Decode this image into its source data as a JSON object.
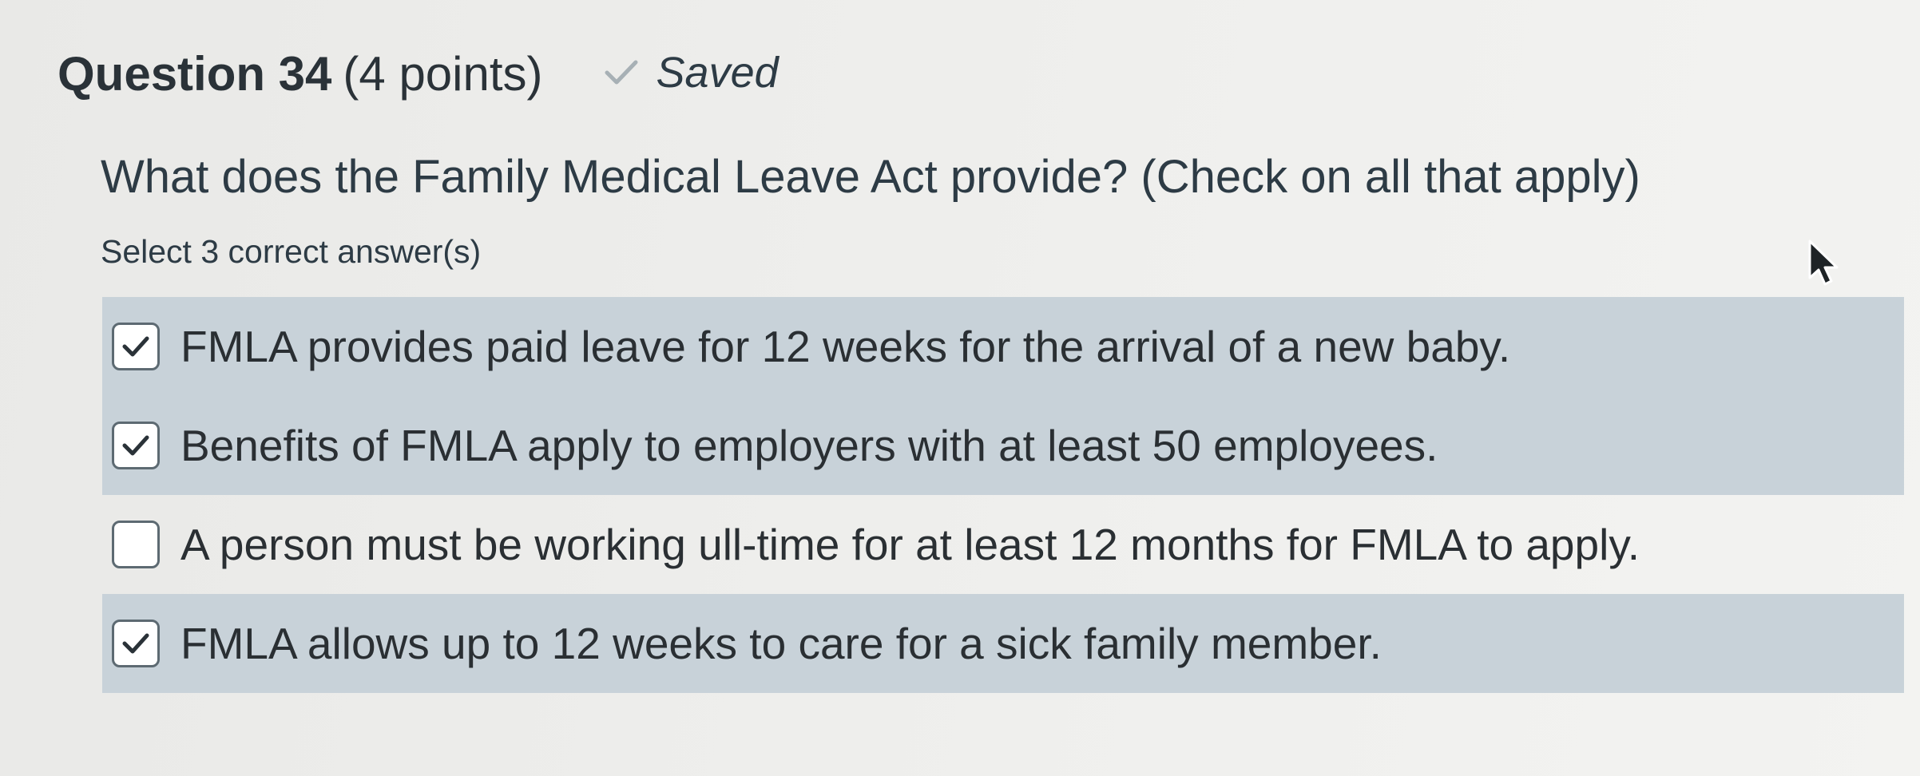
{
  "question": {
    "title": "Question 34",
    "points": "(4 points)",
    "saved_label": "Saved",
    "saved_icon": "check-icon",
    "prompt": "What does the Family Medical Leave Act provide? (Check on all that apply)",
    "instruction": "Select 3 correct answer(s)"
  },
  "answers": [
    {
      "text": "FMLA provides paid leave for 12 weeks for the arrival of a new baby.",
      "checked": true
    },
    {
      "text": "Benefits of FMLA apply to employers with at least 50 employees.",
      "checked": true
    },
    {
      "text": "A person must be working ull-time for at least 12 months for FMLA to apply.",
      "checked": false
    },
    {
      "text": "FMLA allows up to 12 weeks to care for a sick family member.",
      "checked": true
    }
  ],
  "colors": {
    "checked_row_bg": "#c8d2d9",
    "text": "#2d3b45",
    "saved_check": "#a7b0b5"
  }
}
